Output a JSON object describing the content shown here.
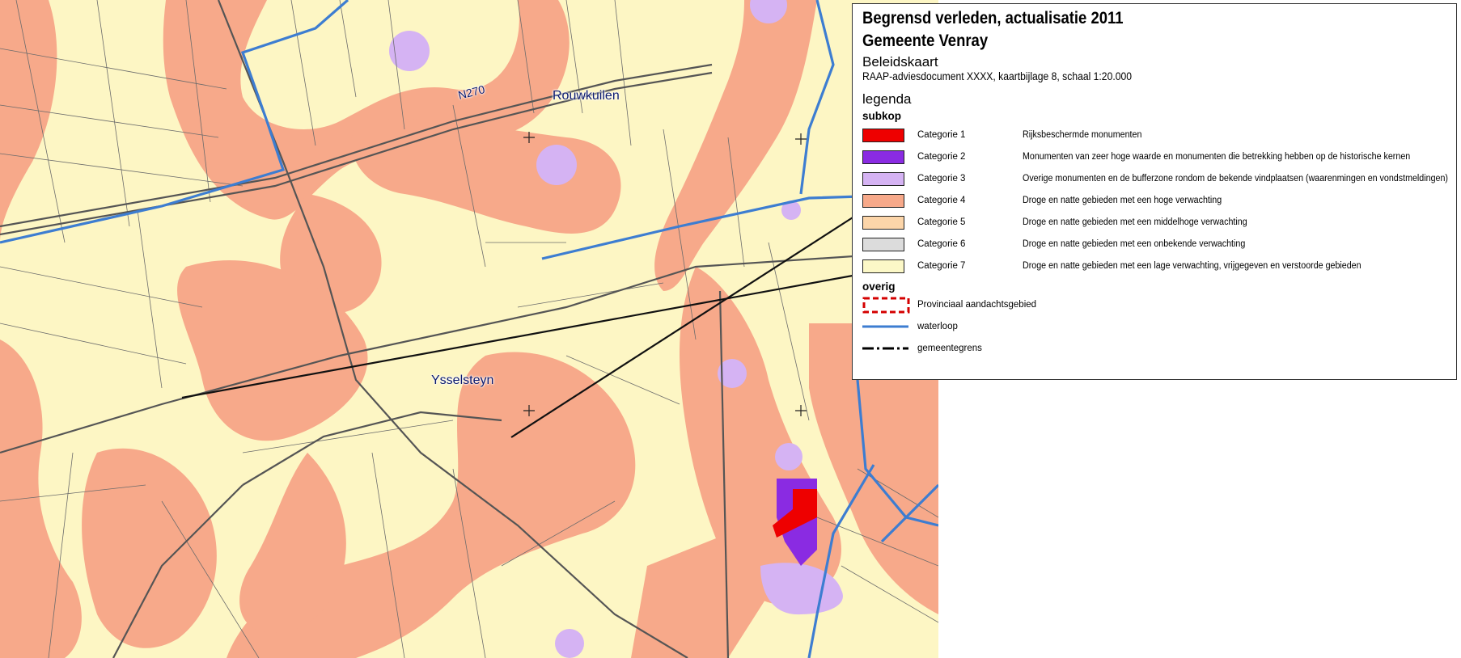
{
  "map": {
    "places": [
      "Rouwkuilen",
      "Ysselsteyn"
    ],
    "road_label": "N270",
    "colors": {
      "background": "#fdf6c4",
      "zone_high": "#f7a98a",
      "zone_lilac": "#d5b3f3",
      "zone_purple": "#8a2be2",
      "zone_red": "#ee0000",
      "waterway": "#3d7dd1",
      "road": "#6b6b6b"
    }
  },
  "legend": {
    "title_line1": "Begrensd verleden, actualisatie 2011",
    "title_line2": "Gemeente Venray",
    "subtitle": "Beleidskaart",
    "source": "RAAP-adviesdocument XXXX, kaartbijlage 8, schaal 1:20.000",
    "heading": "legenda",
    "section_title": "subkop",
    "categories": [
      {
        "label": "Categorie 1",
        "description": "Rijksbeschermde monumenten",
        "color": "#ee0000"
      },
      {
        "label": "Categorie 2",
        "description": "Monumenten van zeer hoge waarde en monumenten die betrekking hebben op de historische kernen",
        "color": "#8a2be2"
      },
      {
        "label": "Categorie 3",
        "description": "Overige monumenten en de bufferzone rondom de bekende vindplaatsen (waarenmingen en vondstmeldingen)",
        "color": "#d5b3f3"
      },
      {
        "label": "Categorie 4",
        "description": "Droge en natte gebieden met een hoge verwachting",
        "color": "#f7a98a"
      },
      {
        "label": "Categorie 5",
        "description": "Droge en natte gebieden met een middelhoge verwachting",
        "color": "#fcd5a9"
      },
      {
        "label": "Categorie 6",
        "description": "Droge en natte gebieden met een onbekende verwachting",
        "color": "#dcdcdc"
      },
      {
        "label": "Categorie 7",
        "description": "Droge en natte gebieden met een lage verwachting, vrijgegeven en verstoorde gebieden",
        "color": "#fcf8c7"
      }
    ],
    "other_title": "overig",
    "other": [
      {
        "label": "Provinciaal aandachtsgebied",
        "icon": "dashed-red-box-icon"
      },
      {
        "label": "waterloop",
        "icon": "blue-line-icon"
      },
      {
        "label": "gemeentegrens",
        "icon": "dash-dot-line-icon"
      }
    ]
  }
}
